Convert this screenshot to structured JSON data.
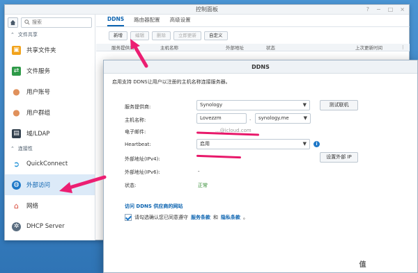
{
  "control_panel": {
    "title": "控制面板",
    "title_ctrls": [
      "?",
      "−",
      "□",
      "×"
    ]
  },
  "sidebar": {
    "search_placeholder": "搜索",
    "sections": {
      "file_sharing": "文件共享",
      "connectivity": "连接性"
    },
    "items": [
      {
        "label": "共享文件夹",
        "icon": "folder-icon",
        "color": "#f2a31b"
      },
      {
        "label": "文件服务",
        "icon": "file-services-icon",
        "color": "#2e9a48"
      },
      {
        "label": "用户账号",
        "icon": "user-icon",
        "color": "#e0915c"
      },
      {
        "label": "用户群组",
        "icon": "group-icon",
        "color": "#e0915c"
      },
      {
        "label": "域/LDAP",
        "icon": "domain-icon",
        "color": "#33414e"
      },
      {
        "label": "QuickConnect",
        "icon": "quickconnect-icon",
        "color": "#1e90d6"
      },
      {
        "label": "外部访问",
        "icon": "globe-icon",
        "color": "#1e78c8"
      },
      {
        "label": "网络",
        "icon": "network-icon",
        "color": "#d94a3a"
      },
      {
        "label": "DHCP Server",
        "icon": "dhcp-icon",
        "color": "#5a6d80"
      }
    ]
  },
  "tabs": [
    "DDNS",
    "路由器配置",
    "高级设置"
  ],
  "toolbar": {
    "add": "新增",
    "edit": "编辑",
    "delete": "删除",
    "update_now": "立即更新",
    "customize": "自定义"
  },
  "table_headers": [
    "服务提供商",
    "主机名称",
    "外部地址",
    "状态",
    "上次更新时间"
  ],
  "dialog": {
    "title": "DDNS",
    "intro": "启用支持 DDNS让用户以注册的主机名称连接服务器。",
    "labels": {
      "provider": "服务提供商:",
      "hostname": "主机名称:",
      "email": "电子邮件:",
      "heartbeat": "Heartbeat:",
      "ipv4": "外部地址(IPv4):",
      "ipv6": "外部地址(IPv6):",
      "status": "状态:"
    },
    "provider_value": "Synology",
    "test_button": "测试联机",
    "hostname_value": "Lovezzm",
    "domain_sep": ".",
    "domain_value": "synology.me",
    "email_value": "...@icloud.com",
    "heartbeat_value": "启用",
    "setup_ip_button": "设置外部 IP",
    "ipv6_value": "-",
    "status_value": "正常",
    "link_heading": "访问 DDNS 供应商的网站",
    "agree_text": "请勾选确认您已同意遵守",
    "terms_link": "服务条款",
    "and": "和",
    "privacy_link": "隐私条款",
    "period": "。"
  },
  "watermark": "值 什么值得买"
}
